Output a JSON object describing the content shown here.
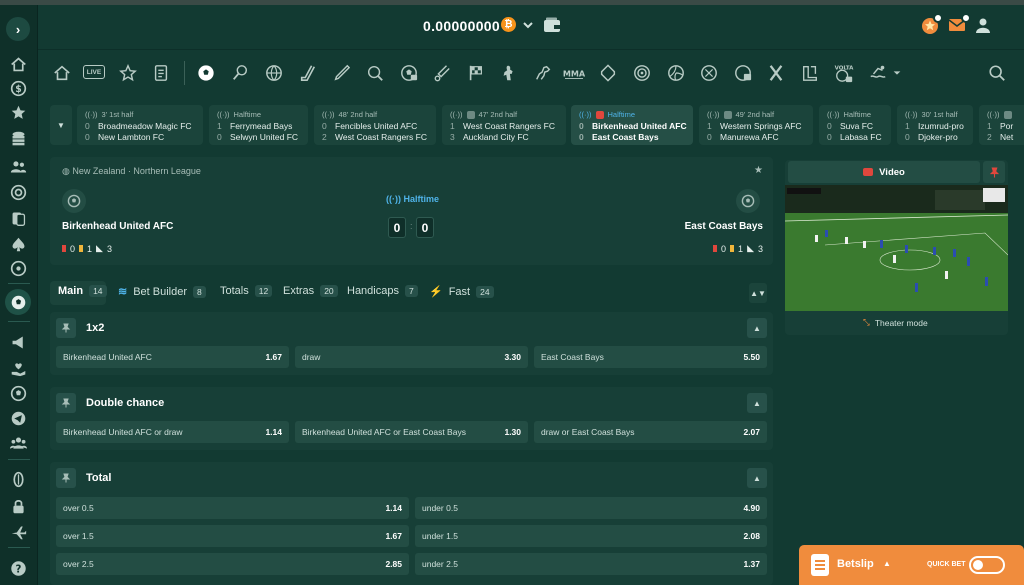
{
  "header": {
    "balance": "0.00000000",
    "currency_icon": "bitcoin-icon",
    "currency_symbol": "₿",
    "icons": [
      "wallet-icon",
      "star-promo-icon",
      "mail-icon",
      "user-icon"
    ]
  },
  "sidebar": {
    "icons": [
      "home-icon",
      "dollar-icon",
      "star-icon",
      "coins-icon",
      "users-icon",
      "casino-chip-icon",
      "cards-icon",
      "spade-icon",
      "slot-icon",
      "soccer-icon",
      "megaphone-icon",
      "heart-hand-icon",
      "soccer-ball-icon",
      "telegram-icon",
      "community-icon",
      "rugby-icon",
      "lock-icon",
      "plane-icon",
      "help-icon"
    ]
  },
  "sportsbar": {
    "live_label": "LIVE",
    "icons": [
      "home-icon",
      "live-icon",
      "favorites-icon",
      "betslip-history-icon",
      "soccer-icon",
      "tennis-icon",
      "basketball-icon",
      "hockey-icon",
      "baseball-bat-icon",
      "table-tennis-icon",
      "esports-soccer-icon",
      "cricket-icon",
      "racing-flag-icon",
      "counter-strike-icon",
      "horse-racing-icon",
      "mma-icon",
      "dota-icon",
      "target-icon",
      "volleyball-icon",
      "handball-icon",
      "esports-icon",
      "lol-icon",
      "valorant-icon",
      "volta-icon",
      "swimming-icon",
      "more-chevron-icon",
      "search-icon"
    ]
  },
  "live_matches": [
    {
      "status": "3' 1st half",
      "team1": "Broadmeadow Magic FC",
      "score1": "0",
      "team2": "New Lambton FC",
      "score2": "0",
      "video": false,
      "active": false
    },
    {
      "status": "Halftime",
      "team1": "Ferrymead Bays",
      "score1": "1",
      "team2": "Selwyn United FC",
      "score2": "0",
      "video": false,
      "active": false
    },
    {
      "status": "48' 2nd half",
      "team1": "Fencibles United AFC",
      "score1": "0",
      "team2": "West Coast Rangers FC",
      "score2": "2",
      "video": false,
      "active": false
    },
    {
      "status": "47' 2nd half",
      "team1": "West Coast Rangers FC",
      "score1": "1",
      "team2": "Auckland City FC",
      "score2": "3",
      "video": true,
      "active": false
    },
    {
      "status": "Halftime",
      "team1": "Birkenhead United AFC",
      "score1": "0",
      "team2": "East Coast Bays",
      "score2": "0",
      "video": true,
      "active": true
    },
    {
      "status": "49' 2nd half",
      "team1": "Western Springs AFC",
      "score1": "1",
      "team2": "Manurewa AFC",
      "score2": "0",
      "video": true,
      "active": false
    },
    {
      "status": "Halftime",
      "team1": "Suva FC",
      "score1": "0",
      "team2": "Labasa FC",
      "score2": "0",
      "video": false,
      "active": false
    },
    {
      "status": "30' 1st half",
      "team1": "Izumrud-pro",
      "score1": "1",
      "team2": "Djoker-pro",
      "score2": "0",
      "video": false,
      "active": false
    },
    {
      "status": "",
      "team1": "Por",
      "score1": "1",
      "team2": "Net",
      "score2": "2",
      "video": true,
      "active": false
    }
  ],
  "event": {
    "league": "New Zealand · Northern League",
    "period": "Halftime",
    "home": {
      "name": "Birkenhead United AFC",
      "score": "0",
      "red": "0",
      "yellow": "1",
      "corners": "3"
    },
    "away": {
      "name": "East Coast Bays",
      "score": "0",
      "red": "0",
      "yellow": "1",
      "corners": "3"
    }
  },
  "market_tabs": [
    {
      "label": "Main",
      "count": "14",
      "active": true
    },
    {
      "label": "Bet Builder",
      "count": "8",
      "active": false
    },
    {
      "label": "Totals",
      "count": "12",
      "active": false
    },
    {
      "label": "Extras",
      "count": "20",
      "active": false
    },
    {
      "label": "Handicaps",
      "count": "7",
      "active": false
    },
    {
      "label": "Fast",
      "count": "24",
      "active": false
    }
  ],
  "markets": {
    "m1x2": {
      "title": "1x2",
      "odds": [
        {
          "label": "Birkenhead United AFC",
          "value": "1.67"
        },
        {
          "label": "draw",
          "value": "3.30"
        },
        {
          "label": "East Coast Bays",
          "value": "5.50"
        }
      ]
    },
    "double_chance": {
      "title": "Double chance",
      "odds": [
        {
          "label": "Birkenhead United AFC or draw",
          "value": "1.14"
        },
        {
          "label": "Birkenhead United AFC or East Coast Bays",
          "value": "1.30"
        },
        {
          "label": "draw or East Coast Bays",
          "value": "2.07"
        }
      ]
    },
    "total": {
      "title": "Total",
      "rows": [
        {
          "over_label": "over 0.5",
          "over": "1.14",
          "under_label": "under 0.5",
          "under": "4.90"
        },
        {
          "over_label": "over 1.5",
          "over": "1.67",
          "under_label": "under 1.5",
          "under": "2.08"
        },
        {
          "over_label": "over 2.5",
          "over": "2.85",
          "under_label": "under 2.5",
          "under": "1.37"
        }
      ]
    }
  },
  "video": {
    "title": "Video",
    "theater_label": "Theater mode"
  },
  "betslip": {
    "label": "Betslip",
    "quick_bet_label": "QUICK BET"
  },
  "colors": {
    "background": "#123a32",
    "panel": "#173f37",
    "button": "#234d44",
    "accent_orange": "#f08c3d",
    "halftime_blue": "#4fb3e8"
  }
}
